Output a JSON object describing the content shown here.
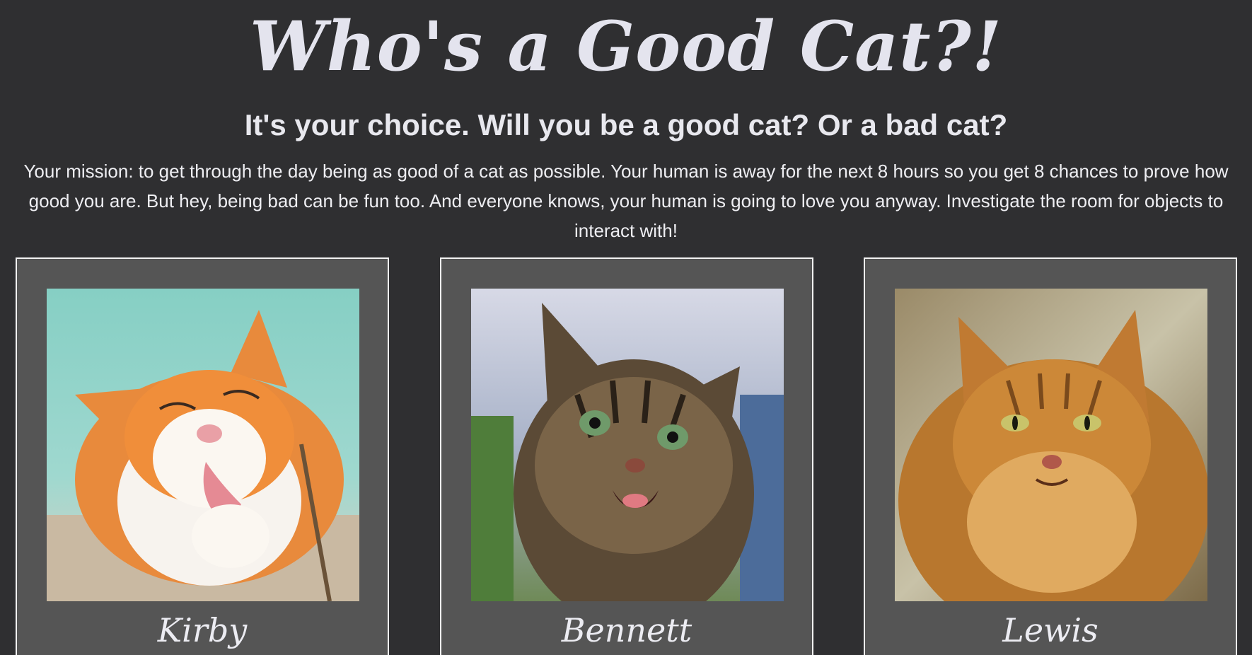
{
  "header": {
    "title": "Who's a Good Cat?!",
    "subtitle": "It's your choice. Will you be a good cat? Or a bad cat?",
    "mission": "Your mission: to get through the day being as good of a cat as possible. Your human is away for the next 8 hours so you get 8 chances to prove how good you are. But hey, being bad can be fun too. And everyone knows, your human is going to love you anyway. Investigate the room for objects to interact with!"
  },
  "cats": [
    {
      "name": "Kirby"
    },
    {
      "name": "Bennett"
    },
    {
      "name": "Lewis"
    }
  ],
  "colors": {
    "background": "#2f2f31",
    "card": "#555555",
    "card_border": "#f2f2f2",
    "text": "#e8e8ee"
  }
}
